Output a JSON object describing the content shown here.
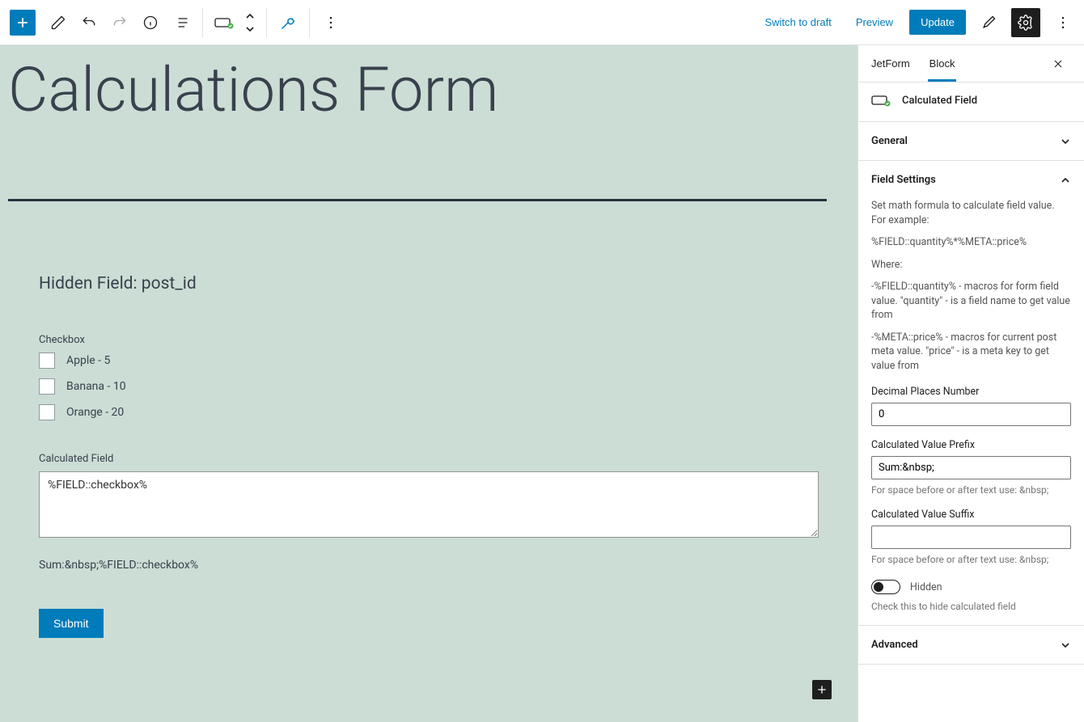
{
  "toolbar": {
    "switch_to_draft": "Switch to draft",
    "preview": "Preview",
    "update": "Update"
  },
  "sidebar": {
    "tabs": {
      "jetform": "JetForm",
      "block": "Block"
    },
    "block_name": "Calculated Field",
    "panels": {
      "general_label": "General",
      "field_settings_label": "Field Settings",
      "advanced_label": "Advanced"
    },
    "field_settings": {
      "intro1": "Set math formula to calculate field value. For example:",
      "intro2": "%FIELD::quantity%*%META::price%",
      "intro3": "Where:",
      "intro4": "-%FIELD::quantity% - macros for form field value. \"quantity\" - is a field name to get value from",
      "intro5": "-%META::price% - macros for current post meta value. \"price\" - is a meta key to get value from",
      "decimal_label": "Decimal Places Number",
      "decimal_value": "0",
      "prefix_label": "Calculated Value Prefix",
      "prefix_value": "Sum:&nbsp;",
      "prefix_help": "For space before or after text use: &nbsp;",
      "suffix_label": "Calculated Value Suffix",
      "suffix_value": "",
      "suffix_help": "For space before or after text use: &nbsp;",
      "hidden_label": "Hidden",
      "hidden_help": "Check this to hide calculated field"
    }
  },
  "canvas": {
    "page_title": "Calculations Form",
    "hidden_field_label": "Hidden Field: post_id",
    "checkbox_group_label": "Checkbox",
    "checkbox_options": [
      {
        "label": "Apple - 5"
      },
      {
        "label": "Banana - 10"
      },
      {
        "label": "Orange - 20"
      }
    ],
    "calculated_label": "Calculated Field",
    "calculated_formula": "%FIELD::checkbox%",
    "sum_line": "Sum:&nbsp;%FIELD::checkbox%",
    "submit_label": "Submit"
  }
}
